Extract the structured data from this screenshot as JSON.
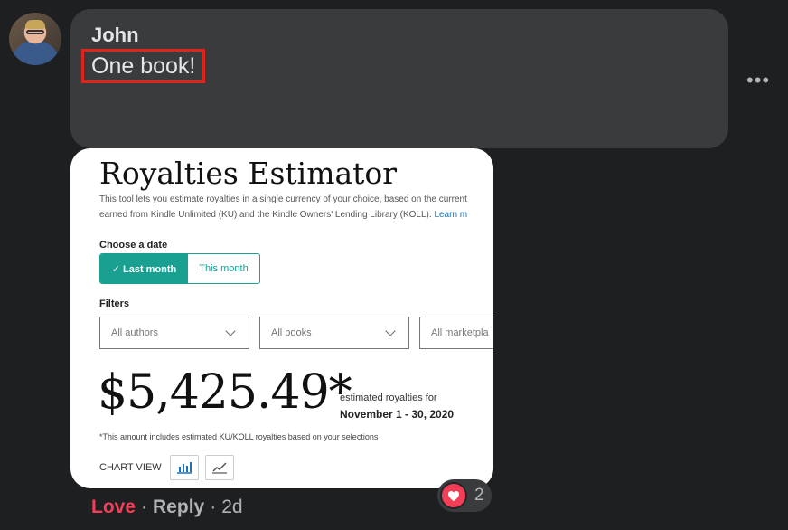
{
  "comment": {
    "author": "John",
    "text": "One book!",
    "more_label": "•••"
  },
  "attachment": {
    "title": "Royalties Estimator",
    "desc_line1": "This tool lets you estimate royalties in a single currency of your choice, based on the current",
    "desc_line2": "earned from Kindle Unlimited (KU) and the Kindle Owners' Lending Library (KOLL).",
    "learn_more": "Learn m",
    "choose_date_label": "Choose a date",
    "toggle": {
      "active": "✓ Last month",
      "inactive": "This month"
    },
    "filters_label": "Filters",
    "filters": [
      "All authors",
      "All books",
      "All marketpla"
    ],
    "amount": "$5,425.49*",
    "estimate_label": "estimated royalties for",
    "estimate_period": "November 1 - 30, 2020",
    "note": "*This amount includes estimated KU/KOLL royalties based on your selections",
    "chart_view_label": "CHART VIEW"
  },
  "reactions": {
    "icon": "heart-icon",
    "count": "2"
  },
  "actions": {
    "love": "Love",
    "reply": "Reply",
    "time": "2d",
    "separator": "·"
  },
  "colors": {
    "love": "#f33e58",
    "teal": "#1aa091",
    "highlight_box": "#e0241b"
  }
}
